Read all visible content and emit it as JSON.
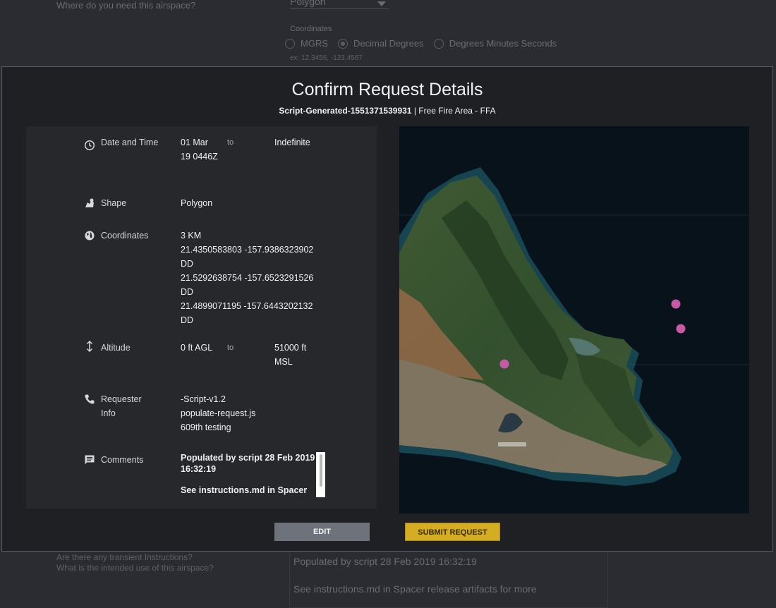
{
  "background": {
    "where_question": "Where do you need this airspace?",
    "shape_select_value": "Polygon",
    "coordinates_label": "Coordinates",
    "coordinate_formats": [
      "MGRS",
      "Decimal Degrees",
      "Degrees Minutes Seconds"
    ],
    "selected_format": "Decimal Degrees",
    "example_hint": "ex: 12.3456, -123.4567",
    "transient_question": "Are there any transient Instructions?",
    "use_question": "What is the intended use of this airspace?",
    "comments_line1": "Populated by script 28 Feb 2019 16:32:19",
    "comments_line2": "See instructions.md in Spacer release artifacts for more"
  },
  "modal": {
    "title": "Confirm Request Details",
    "request_id": "Script-Generated-1551371539931",
    "separator": " | ",
    "area_type": "Free Fire Area - FFA",
    "date_time": {
      "label": "Date and Time",
      "start": "01 Mar 19 0446Z",
      "to": "to",
      "end": "Indefinite"
    },
    "shape": {
      "label": "Shape",
      "value": "Polygon"
    },
    "coordinates": {
      "label": "Coordinates",
      "radius": "3 KM",
      "points": [
        "21.4350583803 -157.9386323902 DD",
        "21.5292638754 -157.6523291526 DD",
        "21.4899071195 -157.6443202132 DD"
      ]
    },
    "altitude": {
      "label": "Altitude",
      "min": "0 ft AGL",
      "to": "to",
      "max": "51000 ft MSL"
    },
    "requester": {
      "label": "Requester Info",
      "lines": [
        "-Script-v1.2",
        "populate-request.js",
        "609th testing"
      ]
    },
    "comments": {
      "label": "Comments",
      "line1": "Populated by script 28 Feb 2019 16:32:19",
      "line2": "See instructions.md in Spacer"
    },
    "buttons": {
      "edit": "EDIT",
      "submit": "SUBMIT REQUEST"
    },
    "map_marker_color": "#c65aa5"
  }
}
